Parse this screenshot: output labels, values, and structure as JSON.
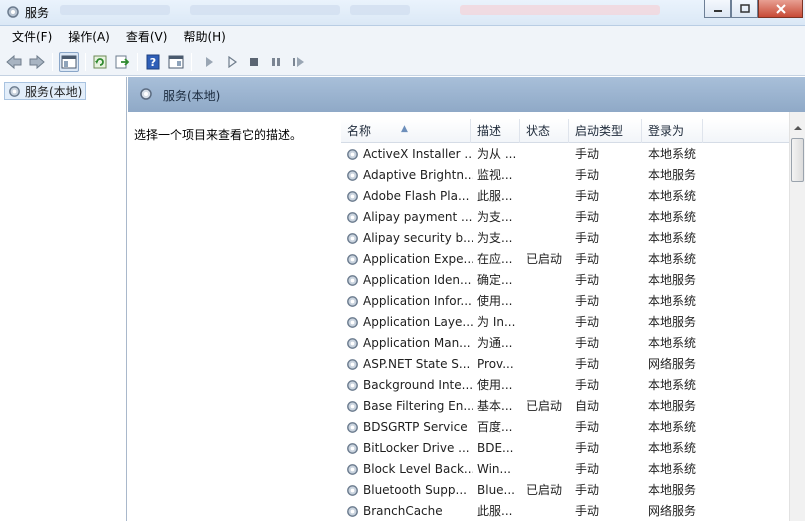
{
  "window": {
    "title": "服务"
  },
  "menu": [
    "文件(F)",
    "操作(A)",
    "查看(V)",
    "帮助(H)"
  ],
  "toolbar": {
    "buttons": [
      "back-icon",
      "forward-icon",
      "show-console-tree-icon",
      "refresh-icon",
      "export-list-icon",
      "help-icon",
      "properties-icon",
      "start-service-icon",
      "start-service-alt-icon",
      "stop-service-icon",
      "pause-service-icon",
      "restart-service-icon"
    ]
  },
  "tree": {
    "node_label": "服务(本地)"
  },
  "pane": {
    "title": "服务(本地)",
    "description": "选择一个项目来查看它的描述。"
  },
  "columns": [
    "名称",
    "描述",
    "状态",
    "启动类型",
    "登录为"
  ],
  "rows": [
    {
      "name": "ActiveX Installer ...",
      "desc": "为从 ...",
      "status": "",
      "startup": "手动",
      "logon": "本地系统"
    },
    {
      "name": "Adaptive Brightn...",
      "desc": "监视...",
      "status": "",
      "startup": "手动",
      "logon": "本地服务"
    },
    {
      "name": "Adobe Flash Pla...",
      "desc": "此服...",
      "status": "",
      "startup": "手动",
      "logon": "本地系统"
    },
    {
      "name": "Alipay payment ...",
      "desc": "为支...",
      "status": "",
      "startup": "手动",
      "logon": "本地系统"
    },
    {
      "name": "Alipay security b...",
      "desc": "为支...",
      "status": "",
      "startup": "手动",
      "logon": "本地系统"
    },
    {
      "name": "Application Expe...",
      "desc": "在应...",
      "status": "已启动",
      "startup": "手动",
      "logon": "本地系统"
    },
    {
      "name": "Application Iden...",
      "desc": "确定...",
      "status": "",
      "startup": "手动",
      "logon": "本地服务"
    },
    {
      "name": "Application Infor...",
      "desc": "使用...",
      "status": "",
      "startup": "手动",
      "logon": "本地系统"
    },
    {
      "name": "Application Laye...",
      "desc": "为 In...",
      "status": "",
      "startup": "手动",
      "logon": "本地服务"
    },
    {
      "name": "Application Man...",
      "desc": "为通...",
      "status": "",
      "startup": "手动",
      "logon": "本地系统"
    },
    {
      "name": "ASP.NET State S...",
      "desc": "Prov...",
      "status": "",
      "startup": "手动",
      "logon": "网络服务"
    },
    {
      "name": "Background Inte...",
      "desc": "使用...",
      "status": "",
      "startup": "手动",
      "logon": "本地系统"
    },
    {
      "name": "Base Filtering En...",
      "desc": "基本...",
      "status": "已启动",
      "startup": "自动",
      "logon": "本地服务"
    },
    {
      "name": "BDSGRTP Service",
      "desc": "百度...",
      "status": "",
      "startup": "手动",
      "logon": "本地系统"
    },
    {
      "name": "BitLocker Drive ...",
      "desc": "BDE...",
      "status": "",
      "startup": "手动",
      "logon": "本地系统"
    },
    {
      "name": "Block Level Back...",
      "desc": "Win...",
      "status": "",
      "startup": "手动",
      "logon": "本地系统"
    },
    {
      "name": "Bluetooth Supp...",
      "desc": "Blue...",
      "status": "已启动",
      "startup": "手动",
      "logon": "本地服务"
    },
    {
      "name": "BranchCache",
      "desc": "此服...",
      "status": "",
      "startup": "手动",
      "logon": "网络服务"
    }
  ]
}
